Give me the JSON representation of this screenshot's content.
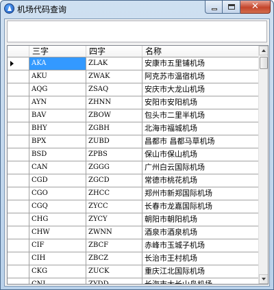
{
  "window": {
    "title": "机场代码查询"
  },
  "search": {
    "value": "",
    "placeholder": ""
  },
  "grid": {
    "columns": [
      "三字",
      "四字",
      "名称"
    ],
    "selected_row": 0,
    "rows": [
      [
        "AKA",
        "ZLAK",
        "安康市五里铺机场"
      ],
      [
        "AKU",
        "ZWAK",
        "阿克苏市温宿机场"
      ],
      [
        "AQG",
        "ZSAQ",
        "安庆市大龙山机场"
      ],
      [
        "AYN",
        "ZHNN",
        "安阳市安阳机场"
      ],
      [
        "BAV",
        "ZBOW",
        "包头市二里半机场"
      ],
      [
        "BHY",
        "ZGBH",
        "北海市福城机场"
      ],
      [
        "BPX",
        "ZUBD",
        "昌都市 昌都马草机场"
      ],
      [
        "BSD",
        "ZPBS",
        "保山市保山机场"
      ],
      [
        "CAN",
        "ZGGG",
        "广州白云国际机场"
      ],
      [
        "CGD",
        "ZGCD",
        "常德市桃花机场"
      ],
      [
        "CGO",
        "ZHCC",
        "郑州市新郑国际机场"
      ],
      [
        "CGQ",
        "ZYCC",
        "长春市龙嘉国际机场"
      ],
      [
        "CHG",
        "ZYCY",
        "朝阳市朝阳机场"
      ],
      [
        "CHW",
        "ZWNN",
        "酒泉市酒泉机场"
      ],
      [
        "CIF",
        "ZBCF",
        "赤峰市玉城子机场"
      ],
      [
        "CIH",
        "ZBCZ",
        "长治市王村机场"
      ],
      [
        "CKG",
        "ZUCK",
        "重庆江北国际机场"
      ],
      [
        "CNI",
        "ZYDD",
        "长海市大长山岛机场"
      ]
    ]
  },
  "colors": {
    "selection": "#3399ff",
    "title_bar": "#b9d1ea",
    "close_button": "#c4452c"
  }
}
